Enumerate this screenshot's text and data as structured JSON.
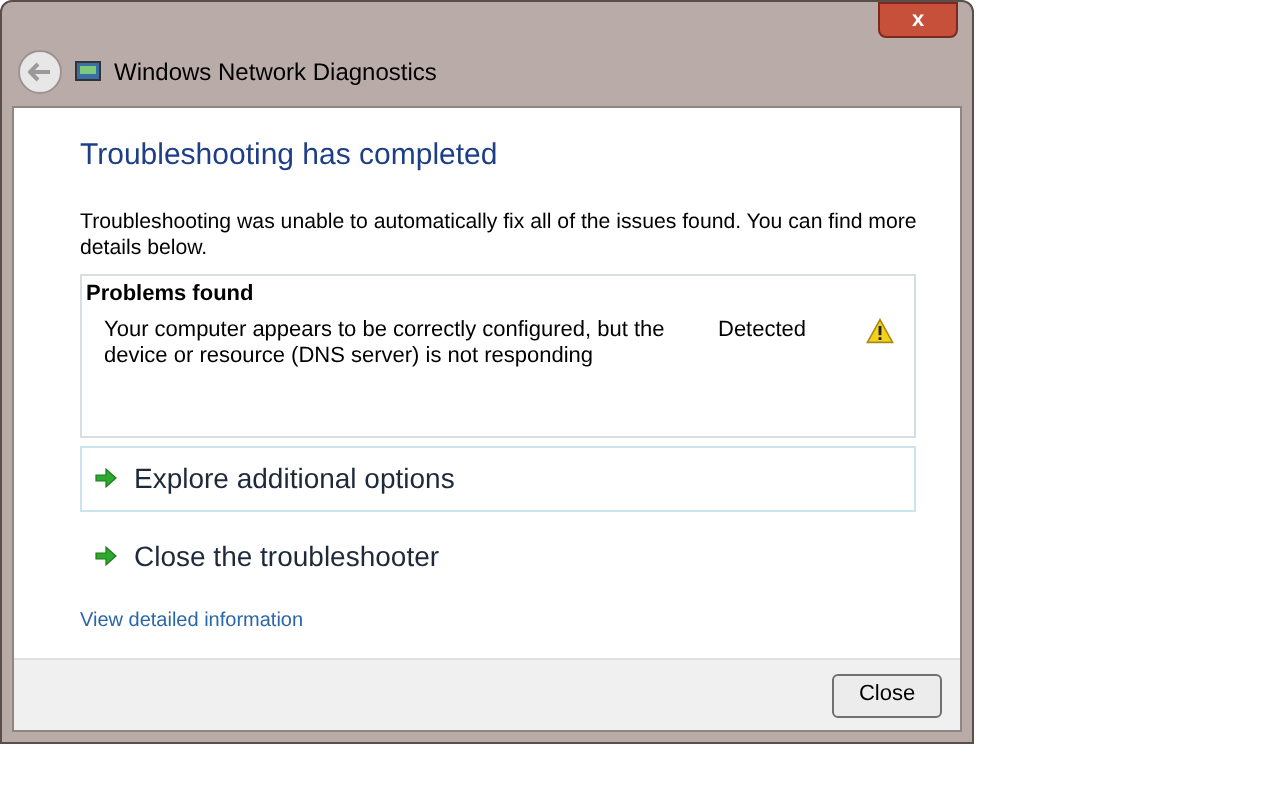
{
  "window": {
    "title": "Windows Network Diagnostics",
    "close_glyph": "x"
  },
  "heading": "Troubleshooting has completed",
  "message": "Troubleshooting was unable to automatically fix all of the issues found. You can find more details below.",
  "problems": {
    "title": "Problems found",
    "items": [
      {
        "description": "Your computer appears to be correctly configured, but the device or resource (DNS server) is not responding",
        "status": "Detected",
        "kind": "warning"
      }
    ]
  },
  "options": [
    {
      "label": "Explore additional options",
      "selected": true
    },
    {
      "label": "Close the troubleshooter",
      "selected": false
    }
  ],
  "link": "View detailed information",
  "buttons": [
    "Close"
  ]
}
